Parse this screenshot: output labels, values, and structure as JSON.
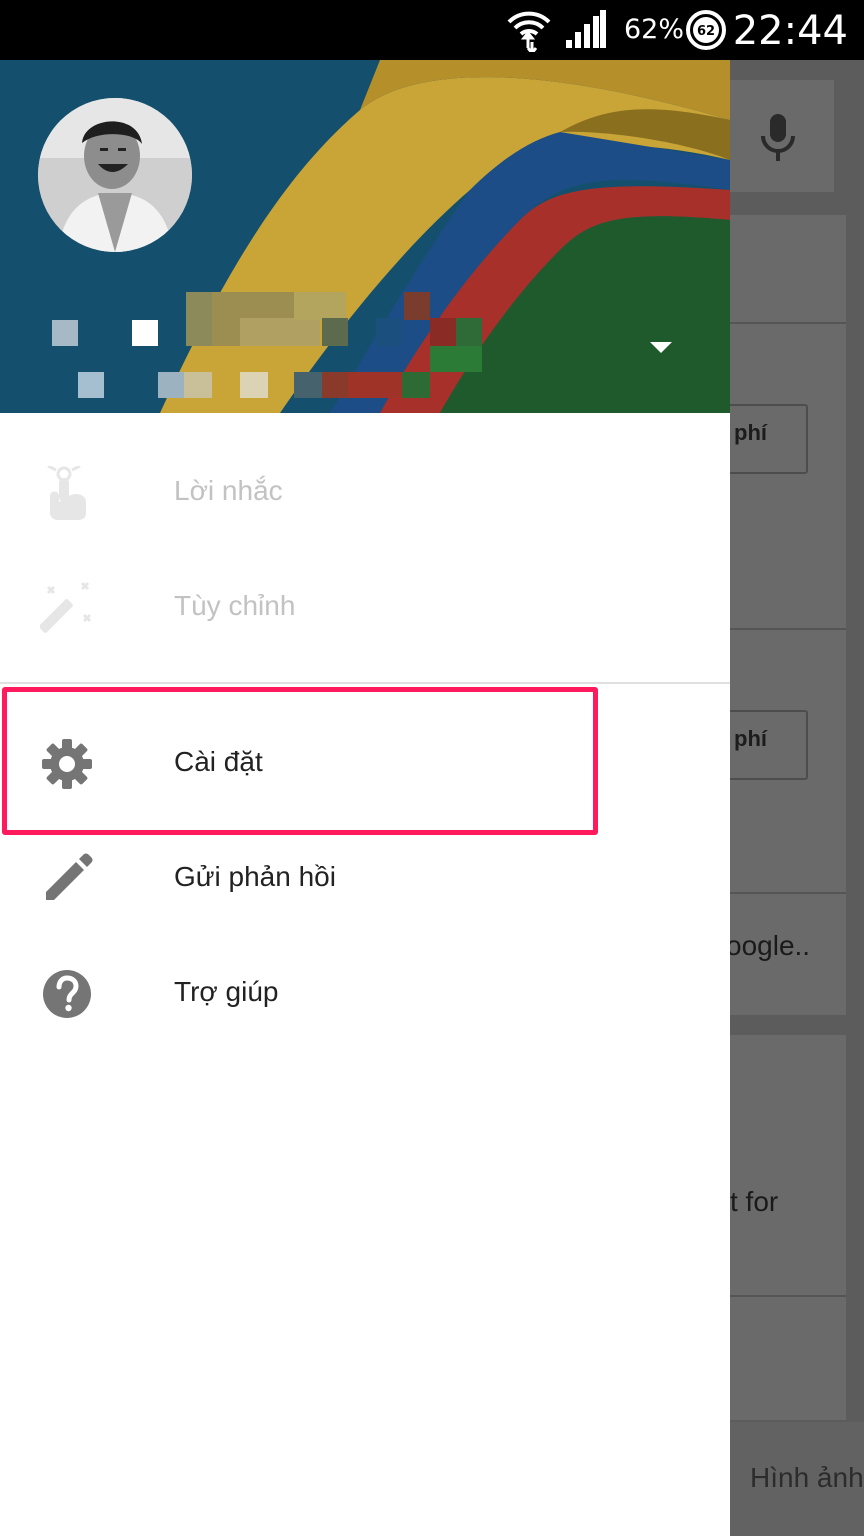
{
  "status_bar": {
    "battery_percent": "62%",
    "battery_ring": "62",
    "time": "22:44"
  },
  "drawer": {
    "account": {
      "name": "",
      "email": ""
    },
    "items": [
      {
        "label": "Lời nhắc",
        "icon": "reminder-finger-icon",
        "enabled": false
      },
      {
        "label": "Tùy chỉnh",
        "icon": "magic-wand-icon",
        "enabled": false
      },
      {
        "label": "Cài đặt",
        "icon": "gear-icon",
        "enabled": true
      },
      {
        "label": "Gửi phản hồi",
        "icon": "pencil-icon",
        "enabled": true
      },
      {
        "label": "Trợ giúp",
        "icon": "help-icon",
        "enabled": true
      }
    ]
  },
  "background_app": {
    "button_1": "phí",
    "button_2": "phí",
    "card_text_1": "oogle..",
    "card_text_2": "t for",
    "bottom_tab": "Hình ảnh"
  },
  "colors": {
    "highlight": "#ff1a5e",
    "header_blue": "#14506e",
    "header_yellow": "#c9a437",
    "header_red": "#a8302a",
    "header_green": "#1f5a2c"
  }
}
